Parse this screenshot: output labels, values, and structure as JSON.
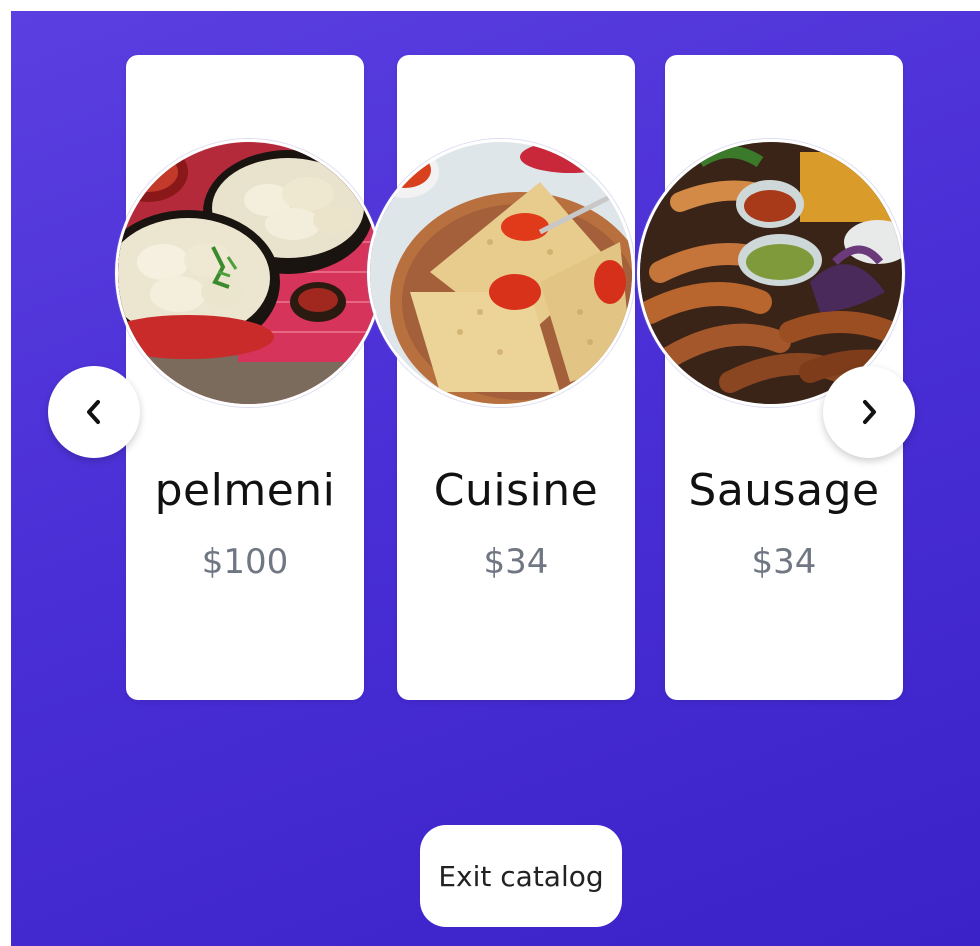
{
  "carousel": {
    "items": [
      {
        "name": "pelmeni",
        "price": "$100",
        "image": "pelmeni-dumplings-photo"
      },
      {
        "name": "Cuisine",
        "price": "$34",
        "image": "pancakes-with-caviar-photo"
      },
      {
        "name": "Sausage",
        "price": "$34",
        "image": "grilled-sausages-platter-photo"
      }
    ],
    "prev_icon": "chevron-left-icon",
    "next_icon": "chevron-right-icon"
  },
  "footer": {
    "exit_label": "Exit catalog"
  },
  "colors": {
    "background_start": "#5b3fe0",
    "background_end": "#3a22c8",
    "card": "#ffffff",
    "title": "#111111",
    "price": "#707782"
  }
}
